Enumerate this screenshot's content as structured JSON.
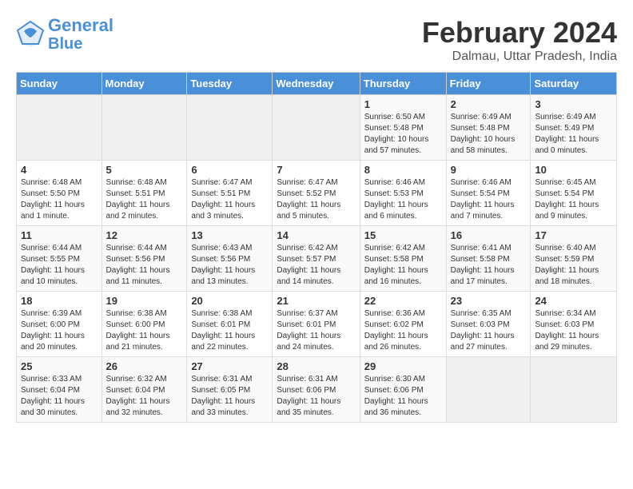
{
  "header": {
    "logo_line1": "General",
    "logo_line2": "Blue",
    "month": "February 2024",
    "location": "Dalmau, Uttar Pradesh, India"
  },
  "columns": [
    "Sunday",
    "Monday",
    "Tuesday",
    "Wednesday",
    "Thursday",
    "Friday",
    "Saturday"
  ],
  "weeks": [
    [
      {
        "day": "",
        "info": ""
      },
      {
        "day": "",
        "info": ""
      },
      {
        "day": "",
        "info": ""
      },
      {
        "day": "",
        "info": ""
      },
      {
        "day": "1",
        "info": "Sunrise: 6:50 AM\nSunset: 5:48 PM\nDaylight: 10 hours and 57 minutes."
      },
      {
        "day": "2",
        "info": "Sunrise: 6:49 AM\nSunset: 5:48 PM\nDaylight: 10 hours and 58 minutes."
      },
      {
        "day": "3",
        "info": "Sunrise: 6:49 AM\nSunset: 5:49 PM\nDaylight: 11 hours and 0 minutes."
      }
    ],
    [
      {
        "day": "4",
        "info": "Sunrise: 6:48 AM\nSunset: 5:50 PM\nDaylight: 11 hours and 1 minute."
      },
      {
        "day": "5",
        "info": "Sunrise: 6:48 AM\nSunset: 5:51 PM\nDaylight: 11 hours and 2 minutes."
      },
      {
        "day": "6",
        "info": "Sunrise: 6:47 AM\nSunset: 5:51 PM\nDaylight: 11 hours and 3 minutes."
      },
      {
        "day": "7",
        "info": "Sunrise: 6:47 AM\nSunset: 5:52 PM\nDaylight: 11 hours and 5 minutes."
      },
      {
        "day": "8",
        "info": "Sunrise: 6:46 AM\nSunset: 5:53 PM\nDaylight: 11 hours and 6 minutes."
      },
      {
        "day": "9",
        "info": "Sunrise: 6:46 AM\nSunset: 5:54 PM\nDaylight: 11 hours and 7 minutes."
      },
      {
        "day": "10",
        "info": "Sunrise: 6:45 AM\nSunset: 5:54 PM\nDaylight: 11 hours and 9 minutes."
      }
    ],
    [
      {
        "day": "11",
        "info": "Sunrise: 6:44 AM\nSunset: 5:55 PM\nDaylight: 11 hours and 10 minutes."
      },
      {
        "day": "12",
        "info": "Sunrise: 6:44 AM\nSunset: 5:56 PM\nDaylight: 11 hours and 11 minutes."
      },
      {
        "day": "13",
        "info": "Sunrise: 6:43 AM\nSunset: 5:56 PM\nDaylight: 11 hours and 13 minutes."
      },
      {
        "day": "14",
        "info": "Sunrise: 6:42 AM\nSunset: 5:57 PM\nDaylight: 11 hours and 14 minutes."
      },
      {
        "day": "15",
        "info": "Sunrise: 6:42 AM\nSunset: 5:58 PM\nDaylight: 11 hours and 16 minutes."
      },
      {
        "day": "16",
        "info": "Sunrise: 6:41 AM\nSunset: 5:58 PM\nDaylight: 11 hours and 17 minutes."
      },
      {
        "day": "17",
        "info": "Sunrise: 6:40 AM\nSunset: 5:59 PM\nDaylight: 11 hours and 18 minutes."
      }
    ],
    [
      {
        "day": "18",
        "info": "Sunrise: 6:39 AM\nSunset: 6:00 PM\nDaylight: 11 hours and 20 minutes."
      },
      {
        "day": "19",
        "info": "Sunrise: 6:38 AM\nSunset: 6:00 PM\nDaylight: 11 hours and 21 minutes."
      },
      {
        "day": "20",
        "info": "Sunrise: 6:38 AM\nSunset: 6:01 PM\nDaylight: 11 hours and 22 minutes."
      },
      {
        "day": "21",
        "info": "Sunrise: 6:37 AM\nSunset: 6:01 PM\nDaylight: 11 hours and 24 minutes."
      },
      {
        "day": "22",
        "info": "Sunrise: 6:36 AM\nSunset: 6:02 PM\nDaylight: 11 hours and 26 minutes."
      },
      {
        "day": "23",
        "info": "Sunrise: 6:35 AM\nSunset: 6:03 PM\nDaylight: 11 hours and 27 minutes."
      },
      {
        "day": "24",
        "info": "Sunrise: 6:34 AM\nSunset: 6:03 PM\nDaylight: 11 hours and 29 minutes."
      }
    ],
    [
      {
        "day": "25",
        "info": "Sunrise: 6:33 AM\nSunset: 6:04 PM\nDaylight: 11 hours and 30 minutes."
      },
      {
        "day": "26",
        "info": "Sunrise: 6:32 AM\nSunset: 6:04 PM\nDaylight: 11 hours and 32 minutes."
      },
      {
        "day": "27",
        "info": "Sunrise: 6:31 AM\nSunset: 6:05 PM\nDaylight: 11 hours and 33 minutes."
      },
      {
        "day": "28",
        "info": "Sunrise: 6:31 AM\nSunset: 6:06 PM\nDaylight: 11 hours and 35 minutes."
      },
      {
        "day": "29",
        "info": "Sunrise: 6:30 AM\nSunset: 6:06 PM\nDaylight: 11 hours and 36 minutes."
      },
      {
        "day": "",
        "info": ""
      },
      {
        "day": "",
        "info": ""
      }
    ]
  ]
}
